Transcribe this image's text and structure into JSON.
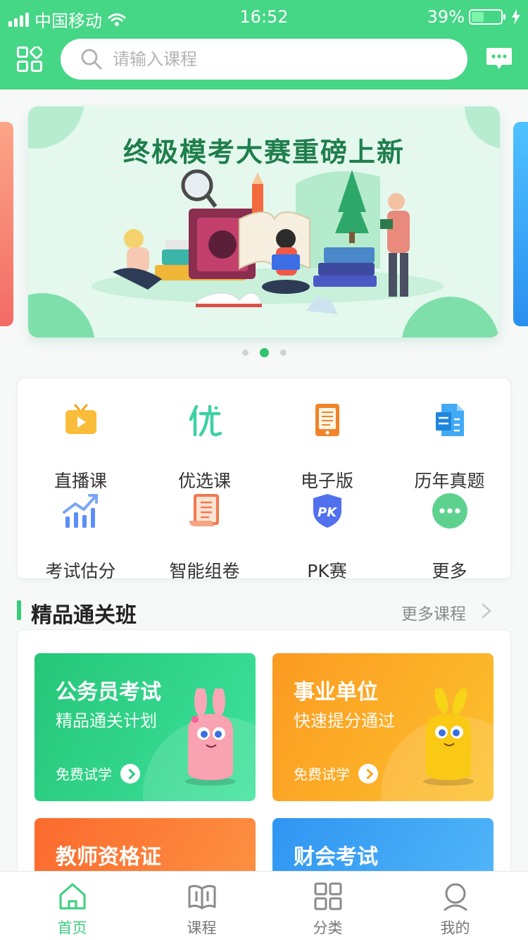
{
  "status_bar": {
    "carrier": "中国移动",
    "time": "16:52",
    "battery": "39%"
  },
  "header": {
    "search_placeholder": "请输入课程"
  },
  "banner": {
    "title": "终极模考大赛重磅上新",
    "active_slide": 2,
    "slide_count": 3
  },
  "menu": [
    {
      "label": "直播课",
      "icon": "live-tv-icon"
    },
    {
      "label": "优选课",
      "icon": "premium-icon"
    },
    {
      "label": "电子版",
      "icon": "ebook-icon"
    },
    {
      "label": "历年真题",
      "icon": "past-papers-icon"
    },
    {
      "label": "考试估分",
      "icon": "score-chart-icon"
    },
    {
      "label": "智能组卷",
      "icon": "scroll-paper-icon"
    },
    {
      "label": "PK赛",
      "icon": "pk-shield-icon"
    },
    {
      "label": "更多",
      "icon": "more-icon"
    }
  ],
  "section": {
    "title": "精品通关班",
    "more_label": "更多课程"
  },
  "courses": [
    {
      "title": "公务员考试",
      "subtitle": "精品通关计划",
      "trial": "免费试学",
      "color": "#2ccb7e"
    },
    {
      "title": "事业单位",
      "subtitle": "快速提分通过",
      "trial": "免费试学",
      "color": "#fca41f"
    },
    {
      "title": "教师资格证",
      "subtitle": "",
      "trial": "",
      "color": "#fb7c3a"
    },
    {
      "title": "财会考试",
      "subtitle": "",
      "trial": "",
      "color": "#3aa4f5"
    }
  ],
  "tabs": [
    {
      "label": "首页",
      "icon": "home-icon",
      "active": true
    },
    {
      "label": "课程",
      "icon": "book-icon",
      "active": false
    },
    {
      "label": "分类",
      "icon": "category-icon",
      "active": false
    },
    {
      "label": "我的",
      "icon": "profile-icon",
      "active": false
    }
  ],
  "colors": {
    "primary": "#45d686",
    "accent": "#2fc371"
  }
}
